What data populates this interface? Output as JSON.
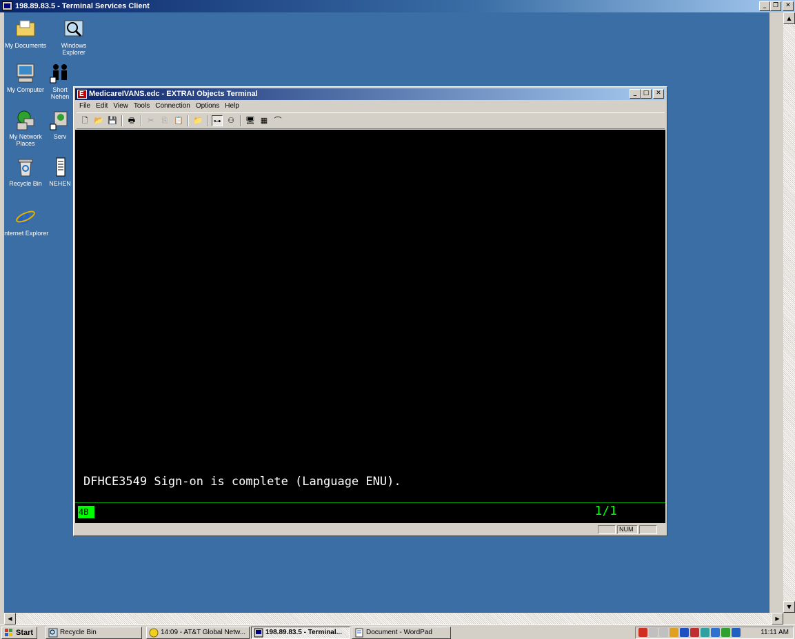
{
  "outer_window": {
    "title": "198.89.83.5 - Terminal Services Client"
  },
  "desktop_icons": [
    {
      "label": "My Documents",
      "icon": "folder-documents-icon"
    },
    {
      "label": "Windows Explorer",
      "icon": "windows-explorer-icon"
    },
    {
      "label": "My Computer",
      "icon": "computer-icon"
    },
    {
      "label": "Short Nehen",
      "icon": "shortcut-people-icon"
    },
    {
      "label": "My Network Places",
      "icon": "network-places-icon"
    },
    {
      "label": "Serv",
      "icon": "network-shortcut-icon"
    },
    {
      "label": "Recycle Bin",
      "icon": "recycle-bin-icon"
    },
    {
      "label": "NEHEN",
      "icon": "document-icon"
    },
    {
      "label": "Internet Explorer",
      "icon": "internet-explorer-icon"
    }
  ],
  "terminal_window": {
    "title": "MedicareIVANS.edc - EXTRA! Objects Terminal",
    "menu": [
      "File",
      "Edit",
      "View",
      "Tools",
      "Connection",
      "Options",
      "Help"
    ],
    "screen_message": "DFHCE3549 Sign-on is complete (Language ENU).",
    "oia_indicator": "4B",
    "cursor_position": "1/1",
    "status_num": "NUM"
  },
  "taskbar": {
    "start_label": "Start",
    "buttons": [
      {
        "label": "Recycle Bin",
        "active": false
      },
      {
        "label": "14:09 - AT&T Global Netw...",
        "active": false
      },
      {
        "label": "198.89.83.5 - Terminal...",
        "active": true
      },
      {
        "label": "Document - WordPad",
        "active": false
      }
    ],
    "clock": "11:11 AM"
  },
  "colors": {
    "desktop": "#3a6ea5",
    "terminal_bg": "#000000",
    "terminal_text": "#ffffff",
    "oia_green": "#00ff00",
    "titlebar": "#0a246a"
  }
}
